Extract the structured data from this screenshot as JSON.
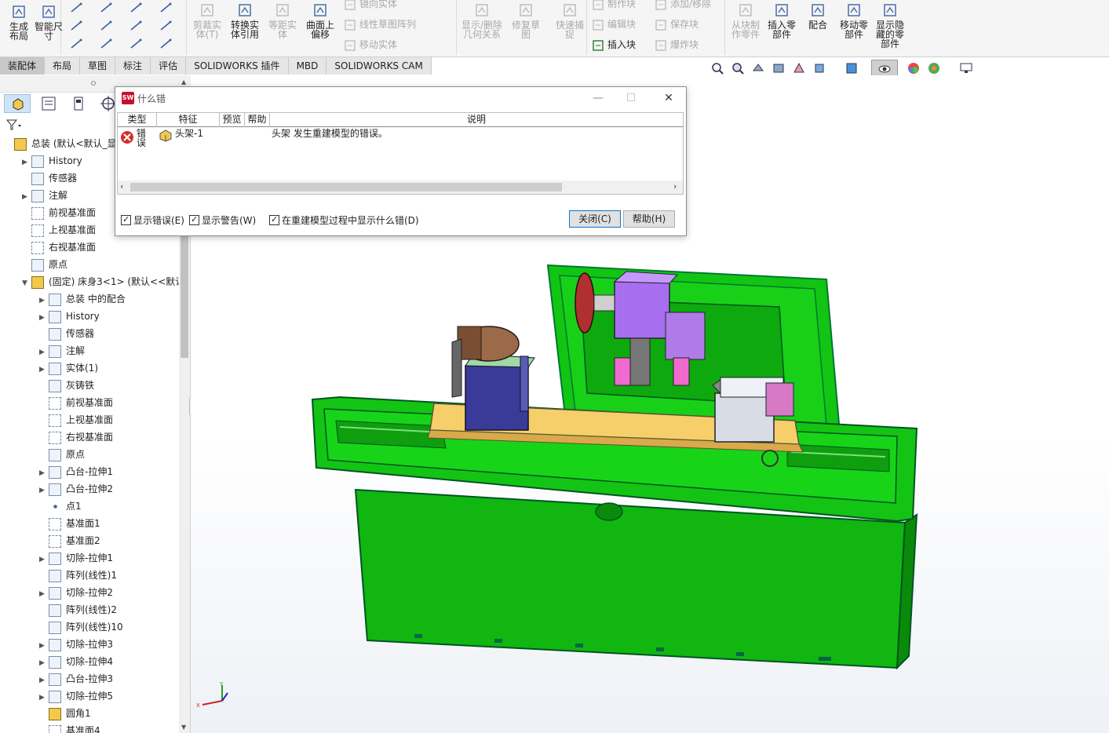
{
  "ribbon": {
    "group1": [
      {
        "label": "生成\n布局",
        "enabled": true,
        "icon": "layout-icon"
      },
      {
        "label": "智能尺\n寸",
        "enabled": true,
        "icon": "smart-dimension-icon"
      }
    ],
    "group2_big": [
      {
        "label": "剪裁实\n体(T)",
        "enabled": false,
        "icon": "trim-entities-icon"
      },
      {
        "label": "转换实\n体引用",
        "enabled": true,
        "icon": "convert-entities-icon"
      },
      {
        "label": "等距实\n体",
        "enabled": false,
        "icon": "offset-entities-icon"
      },
      {
        "label": "曲面上\n偏移",
        "enabled": true,
        "icon": "offset-on-surface-icon"
      }
    ],
    "group2_small": [
      {
        "label": "镜向实体",
        "enabled": false,
        "icon": "mirror-entities-icon"
      },
      {
        "label": "线性草图阵列",
        "enabled": false,
        "icon": "linear-pattern-icon"
      },
      {
        "label": "移动实体",
        "enabled": false,
        "icon": "move-entities-icon"
      }
    ],
    "group3_big": [
      {
        "label": "显示/删除\n几何关系",
        "enabled": false,
        "icon": "relations-icon"
      },
      {
        "label": "修复草\n图",
        "enabled": false,
        "icon": "repair-sketch-icon"
      },
      {
        "label": "快速捕\n捉",
        "enabled": false,
        "icon": "quick-snaps-icon"
      }
    ],
    "group4_small": [
      {
        "label": "制作块",
        "enabled": false,
        "icon": "make-block-icon"
      },
      {
        "label": "编辑块",
        "enabled": false,
        "icon": "edit-block-icon"
      },
      {
        "label": "插入块",
        "enabled": true,
        "icon": "insert-block-icon"
      },
      {
        "label": "添加/移除",
        "enabled": false,
        "icon": "add-remove-icon"
      },
      {
        "label": "保存块",
        "enabled": false,
        "icon": "save-block-icon"
      },
      {
        "label": "爆炸块",
        "enabled": false,
        "icon": "explode-block-icon"
      }
    ],
    "group5_big": [
      {
        "label": "从块制\n作零件",
        "enabled": false,
        "icon": "part-from-block-icon"
      },
      {
        "label": "插入零\n部件",
        "enabled": true,
        "icon": "insert-component-icon"
      },
      {
        "label": "配合",
        "enabled": true,
        "icon": "mate-icon"
      },
      {
        "label": "移动零\n部件",
        "enabled": true,
        "icon": "move-component-icon"
      },
      {
        "label": "显示隐\n藏的零\n部件",
        "enabled": true,
        "icon": "show-hidden-icon"
      }
    ]
  },
  "tabs": [
    {
      "label": "装配体",
      "active": true
    },
    {
      "label": "布局",
      "active": false
    },
    {
      "label": "草图",
      "active": false
    },
    {
      "label": "标注",
      "active": false
    },
    {
      "label": "评估",
      "active": false
    },
    {
      "label": "SOLIDWORKS 插件",
      "active": false
    },
    {
      "label": "MBD",
      "active": false
    },
    {
      "label": "SOLIDWORKS CAM",
      "active": false
    }
  ],
  "tree": [
    {
      "label": "总装  (默认<默认_显示",
      "indent": 0,
      "arrow": "",
      "icon": "assembly-icon"
    },
    {
      "label": "History",
      "indent": 1,
      "arrow": "▶",
      "icon": "history-icon"
    },
    {
      "label": "传感器",
      "indent": 1,
      "arrow": "",
      "icon": "sensor-icon"
    },
    {
      "label": "注解",
      "indent": 1,
      "arrow": "▶",
      "icon": "annotation-icon"
    },
    {
      "label": "前视基准面",
      "indent": 1,
      "arrow": "",
      "icon": "plane-icon"
    },
    {
      "label": "上视基准面",
      "indent": 1,
      "arrow": "",
      "icon": "plane-icon"
    },
    {
      "label": "右视基准面",
      "indent": 1,
      "arrow": "",
      "icon": "plane-icon"
    },
    {
      "label": "原点",
      "indent": 1,
      "arrow": "",
      "icon": "origin-icon"
    },
    {
      "label": "(固定) 床身3<1> (默认<<默认>",
      "indent": 1,
      "arrow": "▼",
      "icon": "part-icon"
    },
    {
      "label": "总装 中的配合",
      "indent": 2,
      "arrow": "▶",
      "icon": "mates-icon"
    },
    {
      "label": "History",
      "indent": 2,
      "arrow": "▶",
      "icon": "history-icon"
    },
    {
      "label": "传感器",
      "indent": 2,
      "arrow": "",
      "icon": "sensor-icon"
    },
    {
      "label": "注解",
      "indent": 2,
      "arrow": "▶",
      "icon": "annotation-icon"
    },
    {
      "label": "实体(1)",
      "indent": 2,
      "arrow": "▶",
      "icon": "solid-bodies-icon"
    },
    {
      "label": "灰铸铁",
      "indent": 2,
      "arrow": "",
      "icon": "material-icon"
    },
    {
      "label": "前视基准面",
      "indent": 2,
      "arrow": "",
      "icon": "plane-icon"
    },
    {
      "label": "上视基准面",
      "indent": 2,
      "arrow": "",
      "icon": "plane-icon"
    },
    {
      "label": "右视基准面",
      "indent": 2,
      "arrow": "",
      "icon": "plane-icon"
    },
    {
      "label": "原点",
      "indent": 2,
      "arrow": "",
      "icon": "origin-icon"
    },
    {
      "label": "凸台-拉伸1",
      "indent": 2,
      "arrow": "▶",
      "icon": "boss-extrude-icon"
    },
    {
      "label": "凸台-拉伸2",
      "indent": 2,
      "arrow": "▶",
      "icon": "boss-extrude-icon"
    },
    {
      "label": "点1",
      "indent": 2,
      "arrow": "",
      "icon": "point-icon"
    },
    {
      "label": "基准面1",
      "indent": 2,
      "arrow": "",
      "icon": "plane-icon"
    },
    {
      "label": "基准面2",
      "indent": 2,
      "arrow": "",
      "icon": "plane-icon"
    },
    {
      "label": "切除-拉伸1",
      "indent": 2,
      "arrow": "▶",
      "icon": "cut-extrude-icon"
    },
    {
      "label": "阵列(线性)1",
      "indent": 2,
      "arrow": "",
      "icon": "linear-pattern-icon"
    },
    {
      "label": "切除-拉伸2",
      "indent": 2,
      "arrow": "▶",
      "icon": "cut-extrude-icon"
    },
    {
      "label": "阵列(线性)2",
      "indent": 2,
      "arrow": "",
      "icon": "linear-pattern-icon"
    },
    {
      "label": "阵列(线性)10",
      "indent": 2,
      "arrow": "",
      "icon": "linear-pattern-icon"
    },
    {
      "label": "切除-拉伸3",
      "indent": 2,
      "arrow": "▶",
      "icon": "cut-extrude-icon"
    },
    {
      "label": "切除-拉伸4",
      "indent": 2,
      "arrow": "▶",
      "icon": "cut-extrude-icon"
    },
    {
      "label": "凸台-拉伸3",
      "indent": 2,
      "arrow": "▶",
      "icon": "boss-extrude-icon"
    },
    {
      "label": "切除-拉伸5",
      "indent": 2,
      "arrow": "▶",
      "icon": "cut-extrude-icon"
    },
    {
      "label": "圆角1",
      "indent": 2,
      "arrow": "",
      "icon": "fillet-icon"
    },
    {
      "label": "基准面4",
      "indent": 2,
      "arrow": "",
      "icon": "plane-icon"
    }
  ],
  "dialog": {
    "title": "什么错",
    "columns": [
      "类型",
      "特征",
      "预览",
      "帮助",
      "说明"
    ],
    "row": {
      "type": "错\n误",
      "feature": "头架-1",
      "description": "头架 发生重建模型的错误。"
    },
    "checks": [
      "显示错误(E)",
      "显示警告(W)",
      "在重建模型过程中显示什么错(D)"
    ],
    "close_label": "关闭(C)",
    "help_label": "帮助(H)"
  },
  "colors": {
    "machine_green": "#10c010",
    "dark_green": "#0a7a0a",
    "rail_yellow": "#f6cf6a",
    "headstock_purple": "#a76ef0"
  }
}
